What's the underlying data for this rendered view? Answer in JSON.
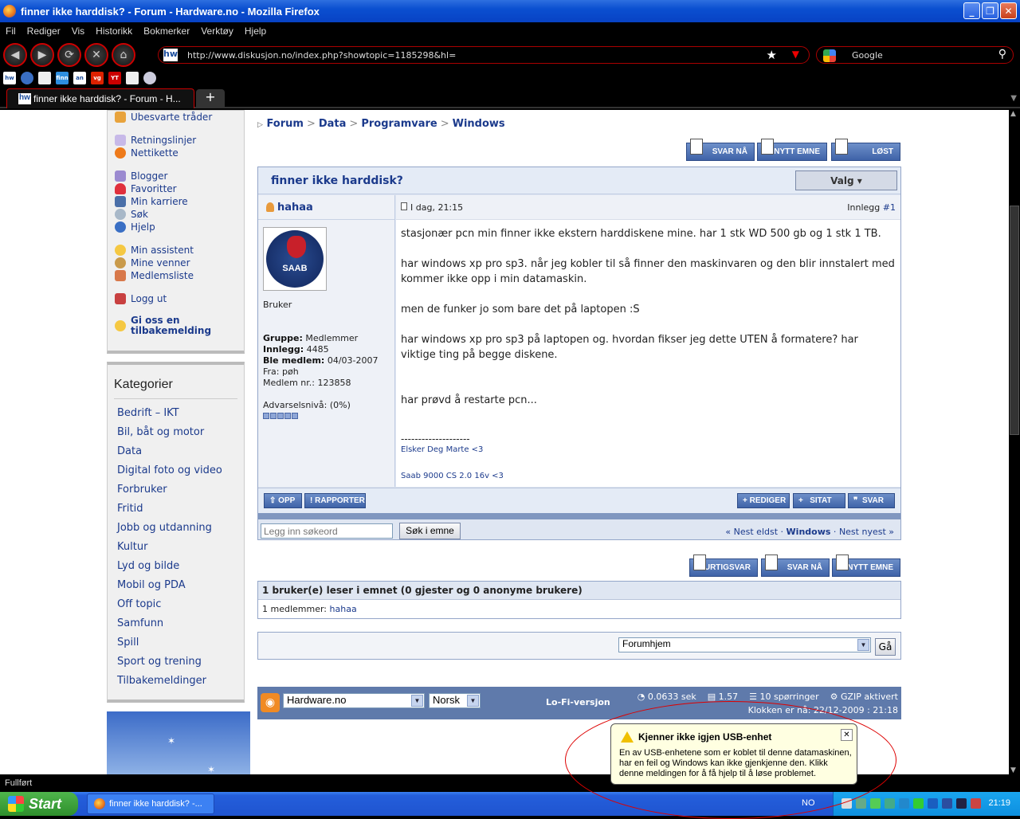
{
  "window": {
    "title": "finner ikke harddisk? - Forum - Hardware.no - Mozilla Firefox"
  },
  "menu": [
    "Fil",
    "Rediger",
    "Vis",
    "Historikk",
    "Bokmerker",
    "Verktøy",
    "Hjelp"
  ],
  "address": {
    "url": "http://www.diskusjon.no/index.php?showtopic=1185298&hl=",
    "search_engine": "Google"
  },
  "tab": {
    "title": "finner ikke harddisk? - Forum - H...",
    "new": "+"
  },
  "status": "Fullført",
  "sidebar": {
    "links_a": [
      "Ubesvarte tråder"
    ],
    "links_b": [
      "Retningslinjer",
      "Nettikette"
    ],
    "links_c": [
      "Blogger",
      "Favoritter",
      "Min karriere",
      "Søk",
      "Hjelp"
    ],
    "links_d": [
      "Min assistent",
      "Mine venner",
      "Medlemsliste"
    ],
    "logout": "Logg ut",
    "feedback": "Gi oss en tilbakemelding",
    "categories_title": "Kategorier",
    "categories": [
      "Bedrift – IKT",
      "Bil, båt og motor",
      "Data",
      "Digital foto og video",
      "Forbruker",
      "Fritid",
      "Jobb og utdanning",
      "Kultur",
      "Lyd og bilde",
      "Mobil og PDA",
      "Off topic",
      "Samfunn",
      "Spill",
      "Sport og trening",
      "Tilbakemeldinger"
    ]
  },
  "breadcrumb": [
    "Forum",
    "Data",
    "Programvare",
    "Windows"
  ],
  "top_buttons": {
    "reply": "SVAR NÅ",
    "new_topic": "NYTT EMNE",
    "solved": "LØST"
  },
  "topic": {
    "title": "finner ikke harddisk?",
    "options": "Valg ▾"
  },
  "post": {
    "author": "hahaa",
    "avatar_text": "SAAB",
    "rank": "Bruker",
    "group_label": "Gruppe:",
    "group": "Medlemmer",
    "posts_label": "Innlegg:",
    "posts": "4485",
    "joined_label": "Ble medlem:",
    "joined": "04/03-2007",
    "from_label": "Fra:",
    "from": "pøh",
    "member_no_label": "Medlem nr.:",
    "member_no": "123858",
    "warn_label": "Advarselsnivå:",
    "warn": "(0%)",
    "date": "I dag, 21:15",
    "post_no_label": "Innlegg",
    "post_no": "#1",
    "body": [
      "stasjonær pcn min finner ikke ekstern harddiskene mine. har 1 stk WD 500 gb og 1 stk 1 TB.",
      "har windows xp pro sp3. når jeg kobler til så finner den maskinvaren og den blir innstalert med kommer ikke opp i min datamaskin.",
      "men de funker jo som bare det på laptopen :S",
      "har windows xp pro sp3 på laptopen og. hvordan fikser jeg dette UTEN å formatere? har viktige ting på begge diskene.",
      "har prøvd å restarte pcn..."
    ],
    "sig_line": "--------------------",
    "sig1": "Elsker Deg Marte <3",
    "sig2": "Saab 9000 CS 2.0 16v <3"
  },
  "post_buttons": {
    "up": "OPP",
    "report": "RAPPORTER",
    "edit": "REDIGER",
    "quote": "SITAT",
    "reply": "SVAR"
  },
  "topic_search": {
    "placeholder": "Legg inn søkeord",
    "button": "Søk i emne"
  },
  "nav": {
    "oldest": "« Nest eldst",
    "sep": " · ",
    "forum": "Windows",
    "newest": "Nest nyest »"
  },
  "bottom_buttons": {
    "quick": "HURTIGSVAR",
    "reply": "SVAR NÅ",
    "new_topic": "NYTT EMNE"
  },
  "readers": {
    "header": "1 bruker(e) leser i emnet (0 gjester og 0 anonyme brukere)",
    "label": "1 medlemmer:",
    "user": "hahaa"
  },
  "jump": {
    "selected": "Forumhjem",
    "go": "Gå"
  },
  "footer": {
    "site": "Hardware.no",
    "lang": "Norsk",
    "lofi": "Lo-Fi-versjon",
    "time": "0.0633 sek",
    "load": "1.57",
    "queries": "10 spørringer",
    "gzip": "GZIP aktivert",
    "clock": "Klokken er nå: 22/12-2009 : 21:18"
  },
  "balloon": {
    "title": "Kjenner ikke igjen USB-enhet",
    "body": "En av USB-enhetene som er koblet til denne datamaskinen, har en feil og Windows kan ikke gjenkjenne den. Klikk denne meldingen for å få hjelp til å løse problemet."
  },
  "taskbar": {
    "start": "Start",
    "task": "finner ikke harddisk? -...",
    "lang": "NO",
    "clock": "21:19"
  }
}
